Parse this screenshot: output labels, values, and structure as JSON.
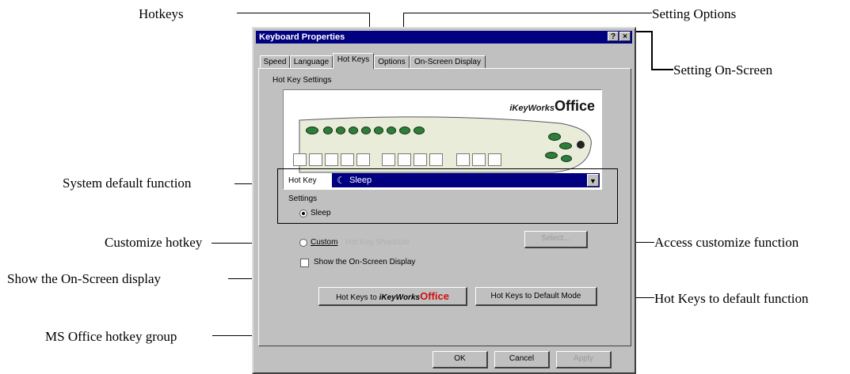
{
  "annotations": {
    "hotkeys": "Hotkeys",
    "setting_options": "Setting Options",
    "setting_onscreen": "Setting On-Screen",
    "system_default": "System default function",
    "customize_hotkey": "Customize hotkey",
    "access_customize": "Access customize function",
    "show_onscreen": "Show the On-Screen display",
    "hotkeys_default": "Hot Keys to default function",
    "ms_office_group": "MS Office hotkey group"
  },
  "dialog": {
    "title": "Keyboard Properties",
    "title_help": "?",
    "title_close": "×",
    "tabs": [
      "Speed",
      "Language",
      "Hot Keys",
      "Options",
      "On-Screen Display"
    ],
    "active_tab": "Hot Keys",
    "section_label": "Hot Key Settings",
    "logo_prefix": "iKeyWorks",
    "logo_suffix": "Office",
    "hotkey_label": "Hot Key",
    "hotkey_value": "Sleep",
    "settings_label": "Settings",
    "radio_sleep": "Sleep",
    "radio_custom": "Custom",
    "custom_field": "Hot Key Shortcuts",
    "select_button": "Select...",
    "show_osd": "Show the On-Screen Display",
    "hotkeys_to_prefix": "Hot Keys to",
    "hotkeys_to_logo": "iKeyWorks",
    "hotkeys_to_logo_suffix": "Office",
    "hotkeys_default_mode": "Hot Keys to Default Mode",
    "ok": "OK",
    "cancel": "Cancel",
    "apply": "Apply"
  },
  "colors": {
    "titlebar": "#000080",
    "face": "#c0c0c0",
    "logo_accent": "#d01010",
    "key_green": "#2e7d3a"
  },
  "state": {
    "sleep_selected": true,
    "custom_selected": false,
    "show_osd_checked": false
  }
}
